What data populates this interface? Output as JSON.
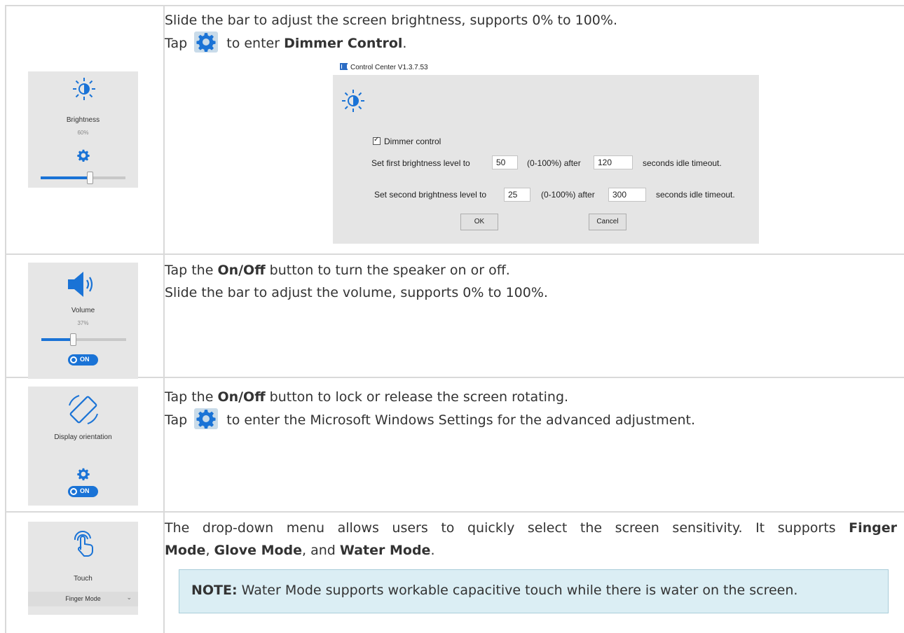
{
  "rows": [
    {
      "tile": {
        "label": "Brightness",
        "value": "60%",
        "slider_level": 0.6
      },
      "desc_lines": [
        [
          {
            "t": "Slide the bar to adjust the screen brightness, supports 0% to 100%."
          }
        ],
        [
          {
            "t": "Tap "
          },
          {
            "icon": "gear-icon"
          },
          {
            "t": " to enter "
          },
          {
            "b": "Dimmer Control"
          },
          {
            "t": "."
          }
        ]
      ]
    },
    {
      "tile": {
        "label": "Volume",
        "value": "37%",
        "slider_level": 0.37,
        "toggle": "ON"
      },
      "desc_lines": [
        [
          {
            "t": "Tap the "
          },
          {
            "b": "On/Off"
          },
          {
            "t": " button to turn the speaker on or off."
          }
        ],
        [
          {
            "t": "Slide the bar to adjust the volume, supports 0% to 100%."
          }
        ]
      ]
    },
    {
      "tile": {
        "label": "Display orientation",
        "toggle": "ON"
      },
      "desc_lines": [
        [
          {
            "t": "Tap the "
          },
          {
            "b": "On/Off"
          },
          {
            "t": " button to lock or release the screen rotating."
          }
        ],
        [
          {
            "t": "Tap "
          },
          {
            "icon": "gear-icon"
          },
          {
            "t": " to enter the Microsoft Windows Settings for the advanced adjustment."
          }
        ]
      ]
    },
    {
      "tile": {
        "label": "Touch",
        "dropdown": "Finger Mode"
      },
      "desc_lines": [
        [
          {
            "t": "The drop-down menu allows users to quickly select the screen sensitivity. It supports "
          },
          {
            "b": "Finger"
          }
        ],
        [
          {
            "b": "Mode"
          },
          {
            "t": ", "
          },
          {
            "b": "Glove Mode"
          },
          {
            "t": ", and "
          },
          {
            "b": "Water Mode"
          },
          {
            "t": "."
          }
        ]
      ]
    }
  ],
  "dialog": {
    "title": "Control Center V1.3.7.53",
    "checkbox_label": "Dimmer control",
    "first_prefix": "Set first brightness level to",
    "first_level": "50",
    "first_mid": "(0-100%) after",
    "first_seconds": "120",
    "first_suffix": "seconds idle timeout.",
    "second_prefix": "Set second brightness level to",
    "second_level": "25",
    "second_mid": "(0-100%) after",
    "second_seconds": "300",
    "second_suffix": "seconds idle timeout.",
    "ok_label": "OK",
    "cancel_label": "Cancel"
  },
  "note": {
    "label": "NOTE:",
    "text": " Water Mode supports workable capacitive touch while there is water on the screen."
  },
  "colors": {
    "accent": "#1a73d6",
    "tile_bg": "#e6e6e6",
    "note_bg": "#dbeef4",
    "border": "#d9d9d9"
  }
}
